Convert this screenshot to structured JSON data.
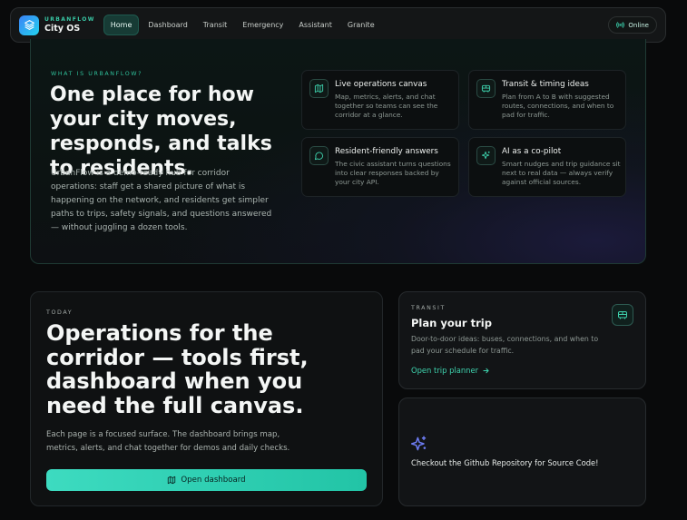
{
  "brand": {
    "kicker": "URBANFLOW",
    "name": "City OS"
  },
  "nav": {
    "tabs": [
      {
        "label": "Home",
        "active": true
      },
      {
        "label": "Dashboard"
      },
      {
        "label": "Transit"
      },
      {
        "label": "Emergency"
      },
      {
        "label": "Assistant"
      },
      {
        "label": "Granite"
      }
    ],
    "status": "Online"
  },
  "hero": {
    "kicker": "WHAT IS URBANFLOW?",
    "title": "One place for how your city moves, responds, and talks to residents.",
    "body": "UrbanFlow is a demo-ready hub for corridor operations: staff get a shared picture of what is happening on the network, and residents get simpler paths to trips, safety signals, and questions answered — without juggling a dozen tools.",
    "cards": [
      {
        "icon": "map-icon",
        "title": "Live operations canvas",
        "text": "Map, metrics, alerts, and chat together so teams can see the corridor at a glance."
      },
      {
        "icon": "bus-icon",
        "title": "Transit & timing ideas",
        "text": "Plan from A to B with suggested routes, connections, and when to pad for traffic."
      },
      {
        "icon": "chat-icon",
        "title": "Resident-friendly answers",
        "text": "The civic assistant turns questions into clear responses backed by your city API."
      },
      {
        "icon": "sparkles-icon",
        "title": "AI as a co-pilot",
        "text": "Smart nudges and trip guidance sit next to real data — always verify against official sources."
      }
    ]
  },
  "ops": {
    "kicker": "TODAY",
    "title": "Operations for the corridor — tools first, dashboard when you need the full canvas.",
    "body": "Each page is a focused surface. The dashboard brings map, metrics, alerts, and chat together for demos and daily checks.",
    "button": "Open dashboard"
  },
  "transit": {
    "kicker": "TRANSIT",
    "title": "Plan your trip",
    "body": "Door-to-door ideas: buses, connections, and when to pad your schedule for traffic.",
    "link": "Open trip planner"
  },
  "github": {
    "text": "Checkout the Github Repository for Source Code!"
  },
  "colors": {
    "accent": "#39c9a6",
    "background": "#090a0b",
    "button": "#2fd4b5"
  }
}
